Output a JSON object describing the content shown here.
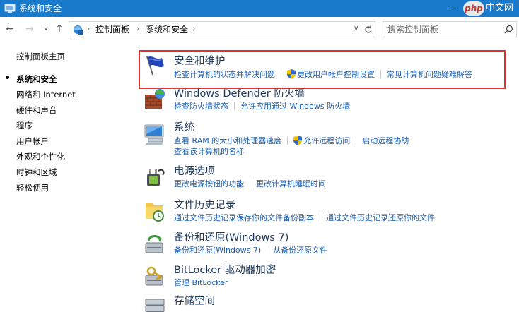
{
  "window": {
    "title": "系统和安全",
    "watermark_left": "php",
    "watermark_right": "中文网"
  },
  "address": {
    "crumbs": [
      "控制面板",
      "系统和安全"
    ],
    "search_placeholder": "搜索控制面板"
  },
  "leftnav": {
    "home": "控制面板主页",
    "items": [
      "系统和安全",
      "网络和 Internet",
      "硬件和声音",
      "程序",
      "用户帐户",
      "外观和个性化",
      "时钟和区域",
      "轻松使用"
    ]
  },
  "categories": [
    {
      "title": "安全和维护",
      "icon": "flag-icon",
      "links": [
        "检查计算机的状态并解决问题",
        "更改用户帐户控制设置",
        "常见计算机问题疑难解答"
      ],
      "shield_on": [
        1
      ]
    },
    {
      "title": "Windows Defender 防火墙",
      "icon": "firewall-icon",
      "links": [
        "检查防火墙状态",
        "允许应用通过 Windows 防火墙"
      ],
      "shield_on": []
    },
    {
      "title": "系统",
      "icon": "computer-icon",
      "links": [
        "查看 RAM 的大小和处理器速度",
        "允许远程访问",
        "启动远程协助"
      ],
      "links2": [
        "查看该计算机的名称"
      ],
      "shield_on": [
        1
      ]
    },
    {
      "title": "电源选项",
      "icon": "power-icon",
      "links": [
        "更改电源按钮的功能",
        "更改计算机睡眠时间"
      ],
      "shield_on": []
    },
    {
      "title": "文件历史记录",
      "icon": "file-history-icon",
      "links": [
        "通过文件历史记录保存你的文件备份副本",
        "通过文件历史记录还原你的文件"
      ],
      "shield_on": []
    },
    {
      "title": "备份和还原(Windows 7)",
      "icon": "backup-icon",
      "links": [
        "备份和还原(Windows 7)",
        "从备份还原文件"
      ],
      "shield_on": []
    },
    {
      "title": "BitLocker 驱动器加密",
      "icon": "bitlocker-icon",
      "links": [
        "管理 BitLocker"
      ],
      "shield_on": []
    },
    {
      "title": "存储空间",
      "icon": "storage-icon",
      "links": [],
      "shield_on": []
    }
  ],
  "colors": {
    "titlebar": "#1979ca",
    "link": "#1a5fb4",
    "heading": "#1e395b",
    "highlight": "#e0312c"
  }
}
